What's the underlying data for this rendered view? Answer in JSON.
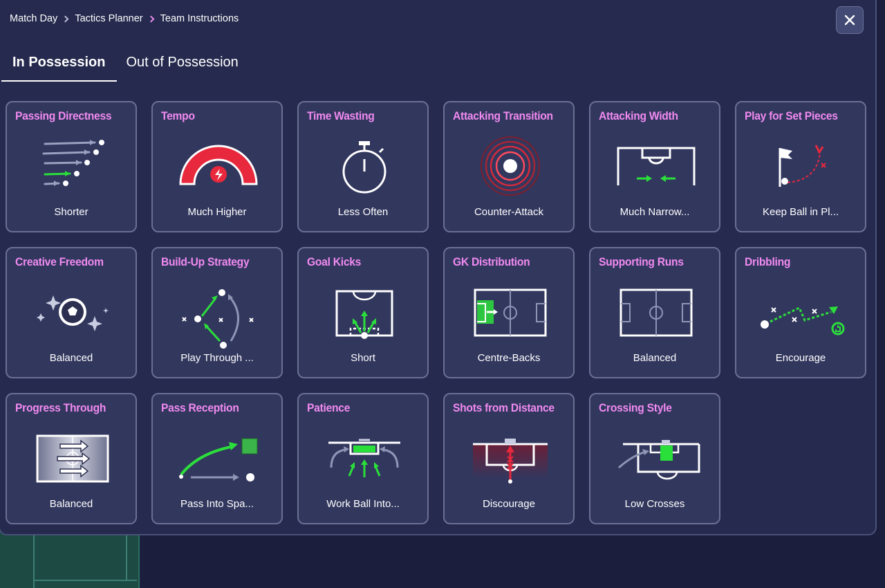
{
  "breadcrumb": [
    "Match Day",
    "Tactics Planner",
    "Team Instructions"
  ],
  "tabs": [
    {
      "label": "In Possession",
      "active": true
    },
    {
      "label": "Out of Possession",
      "active": false
    }
  ],
  "cards": [
    {
      "title": "Passing Directness",
      "value": "Shorter",
      "icon": "passing-directness-icon"
    },
    {
      "title": "Tempo",
      "value": "Much Higher",
      "icon": "tempo-gauge-icon"
    },
    {
      "title": "Time Wasting",
      "value": "Less Often",
      "icon": "stopwatch-icon"
    },
    {
      "title": "Attacking Transition",
      "value": "Counter-Attack",
      "icon": "target-rings-icon"
    },
    {
      "title": "Attacking Width",
      "value": "Much Narrow...",
      "icon": "narrow-width-icon"
    },
    {
      "title": "Play for Set Pieces",
      "value": "Keep Ball in Pl...",
      "icon": "corner-flag-icon"
    },
    {
      "title": "Creative Freedom",
      "value": "Balanced",
      "icon": "ball-sparkles-icon"
    },
    {
      "title": "Build-Up Strategy",
      "value": "Play Through ...",
      "icon": "build-up-icon"
    },
    {
      "title": "Goal Kicks",
      "value": "Short",
      "icon": "goal-kick-icon"
    },
    {
      "title": "GK Distribution",
      "value": "Centre-Backs",
      "icon": "gk-distribution-icon"
    },
    {
      "title": "Supporting Runs",
      "value": "Balanced",
      "icon": "pitch-icon"
    },
    {
      "title": "Dribbling",
      "value": "Encourage",
      "icon": "dribbling-icon"
    },
    {
      "title": "Progress Through",
      "value": "Balanced",
      "icon": "progress-arrows-icon"
    },
    {
      "title": "Pass Reception",
      "value": "Pass Into Spa...",
      "icon": "pass-reception-icon"
    },
    {
      "title": "Patience",
      "value": "Work Ball Into...",
      "icon": "patience-icon"
    },
    {
      "title": "Shots from Distance",
      "value": "Discourage",
      "icon": "shots-distance-icon"
    },
    {
      "title": "Crossing Style",
      "value": "Low Crosses",
      "icon": "crossing-icon"
    }
  ],
  "colors": {
    "accent": "#f08af0",
    "green": "#2bdf3b",
    "red": "#e8283c",
    "card": "#32375e",
    "panel": "#252a4e"
  }
}
